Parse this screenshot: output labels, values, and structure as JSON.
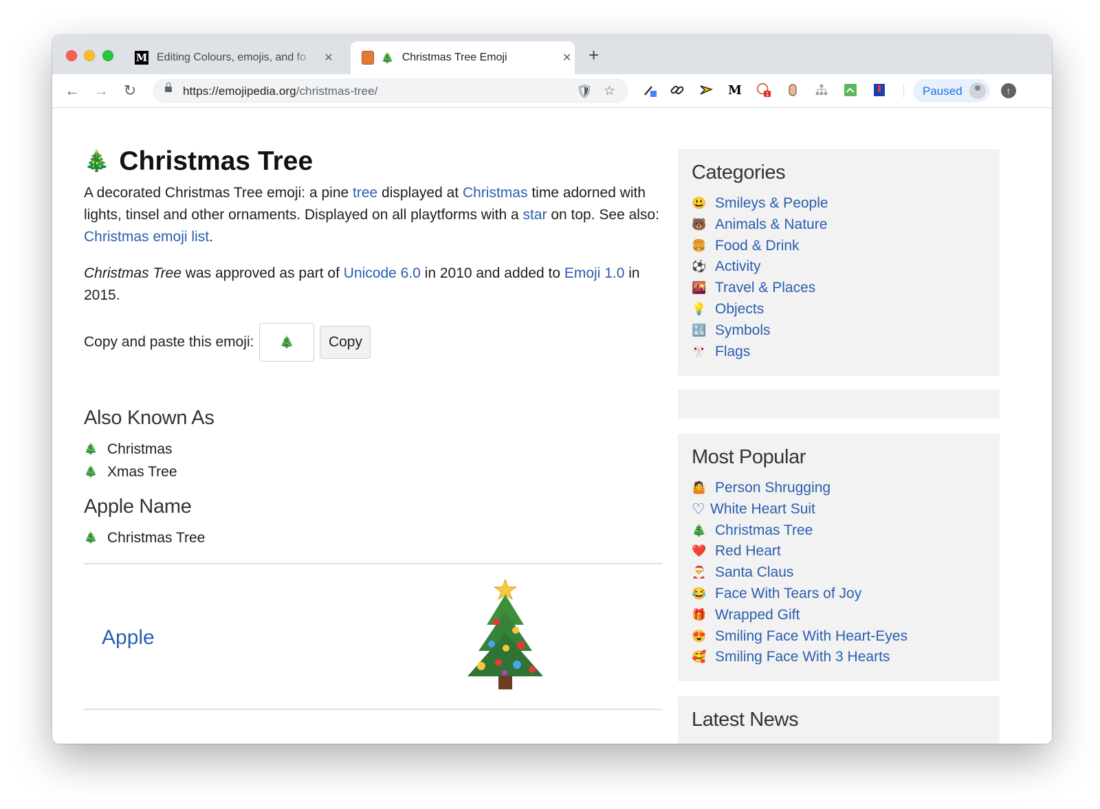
{
  "browser": {
    "tabs": [
      {
        "title": "Editing Colours, emojis, and fo",
        "favicon": "medium-m-icon",
        "active": false
      },
      {
        "title": "Christmas Tree Emoji",
        "favicon": "christmas-tree-icon",
        "active": true
      }
    ],
    "new_tab": "+",
    "url_host": "https://emojipedia.org",
    "url_path": "/christmas-tree/",
    "paused_label": "Paused",
    "extensions": [
      "eyedropper-icon",
      "link-icon",
      "folder-arrow-icon",
      "medium-m-icon",
      "badge-icon",
      "clipboard-icon",
      "tree-network-icon",
      "image-refresh-icon",
      "bookmark-ribbon-icon"
    ],
    "extension_badge": "1"
  },
  "article": {
    "title_emoji": "🎄",
    "title": "Christmas Tree",
    "desc_1": "A decorated Christmas Tree emoji: a pine ",
    "link_tree": "tree",
    "desc_2": " displayed at ",
    "link_christmas": "Christmas",
    "desc_3": " time adorned with lights, tinsel and other ornaments. Displayed on all playtforms with a ",
    "link_star": "star",
    "desc_4": " on top. See also: ",
    "link_list": "Christmas emoji list",
    "desc_5": ".",
    "approved_em": "Christmas Tree",
    "approved_1": " was approved as part of ",
    "link_unicode": "Unicode 6.0",
    "approved_2": " in 2010 and added to ",
    "link_emoji": "Emoji 1.0",
    "approved_3": " in 2015.",
    "copy_label": "Copy and paste this emoji:",
    "copy_value": "🎄",
    "copy_button": "Copy",
    "aka_title": "Also Known As",
    "aka": [
      "Christmas",
      "Xmas Tree"
    ],
    "apple_name_title": "Apple Name",
    "apple_name": "Christmas Tree",
    "vendor": "Apple"
  },
  "sidebar": {
    "categories_title": "Categories",
    "categories": [
      {
        "emoji": "😃",
        "label": "Smileys & People"
      },
      {
        "emoji": "🐻",
        "label": "Animals & Nature"
      },
      {
        "emoji": "🍔",
        "label": "Food & Drink"
      },
      {
        "emoji": "⚽",
        "label": "Activity"
      },
      {
        "emoji": "🌇",
        "label": "Travel & Places"
      },
      {
        "emoji": "💡",
        "label": "Objects"
      },
      {
        "emoji": "🔣",
        "label": "Symbols"
      },
      {
        "emoji": "🎌",
        "label": "Flags"
      }
    ],
    "popular_title": "Most Popular",
    "popular": [
      {
        "emoji": "🤷",
        "label": "Person Shrugging"
      },
      {
        "emoji": "♡",
        "label": "White Heart Suit"
      },
      {
        "emoji": "🎄",
        "label": "Christmas Tree"
      },
      {
        "emoji": "❤️",
        "label": "Red Heart"
      },
      {
        "emoji": "🎅",
        "label": "Santa Claus"
      },
      {
        "emoji": "😂",
        "label": "Face With Tears of Joy"
      },
      {
        "emoji": "🎁",
        "label": "Wrapped Gift"
      },
      {
        "emoji": "😍",
        "label": "Smiling Face With Heart-Eyes"
      },
      {
        "emoji": "🥰",
        "label": "Smiling Face With 3 Hearts"
      }
    ],
    "news_title": "Latest News"
  },
  "colors": {
    "link": "#2a5db0",
    "accent": "#1a73e8",
    "tabstrip": "#dee1e6"
  }
}
